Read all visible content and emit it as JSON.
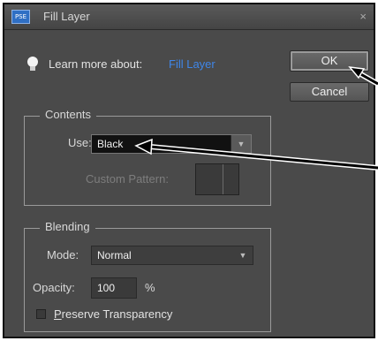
{
  "window": {
    "title": "Fill Layer",
    "app_icon_text": "PSE",
    "close_glyph": "×"
  },
  "help": {
    "text": "Learn more about:",
    "link_text": "Fill Layer"
  },
  "buttons": {
    "ok": "OK",
    "cancel": "Cancel"
  },
  "contents": {
    "group_label": "Contents",
    "use_label": "Use:",
    "use_value": "Black",
    "custom_pattern_label": "Custom Pattern:"
  },
  "blending": {
    "group_label": "Blending",
    "mode_label": "Mode:",
    "mode_value": "Normal",
    "opacity_label": "Opacity:",
    "opacity_value": "100",
    "opacity_unit": "%",
    "preserve_first": "P",
    "preserve_rest": "reserve Transparency"
  },
  "colors": {
    "dialog_bg": "#4a4a4a",
    "link": "#3f86e8",
    "annotation_arrow": "#000000"
  }
}
